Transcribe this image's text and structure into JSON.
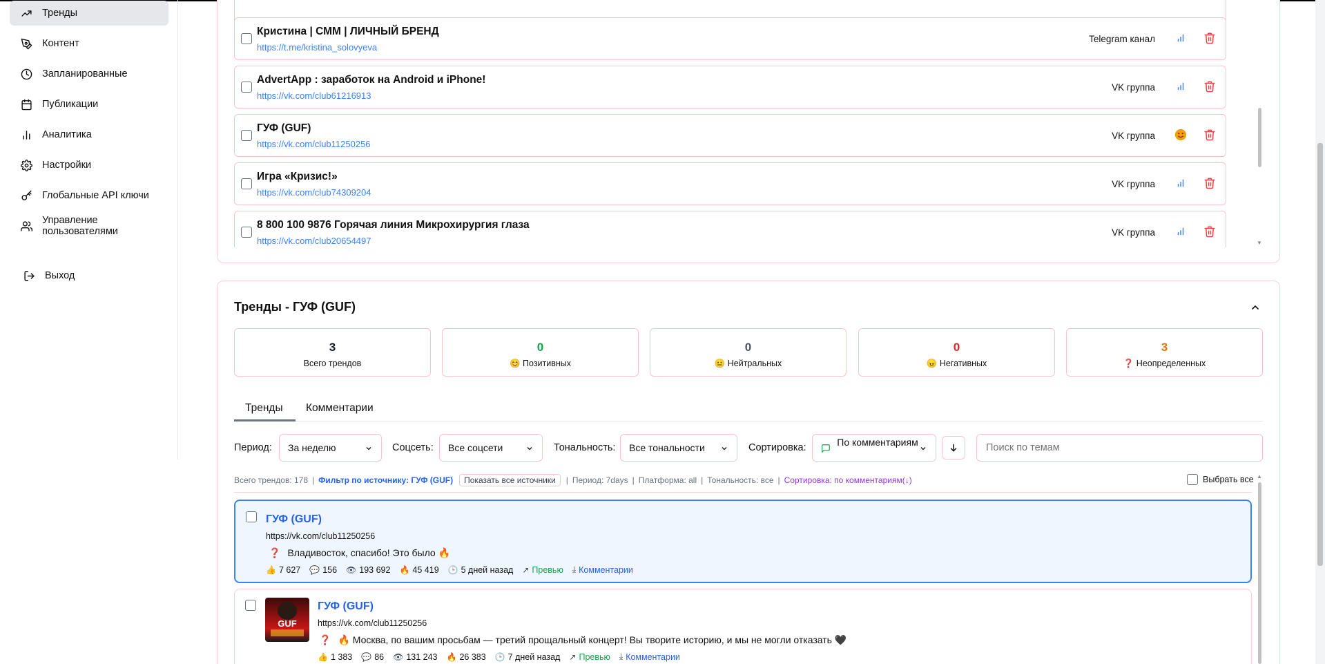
{
  "sidebar": {
    "items": [
      {
        "label": "Тренды",
        "icon": "trending-up-icon",
        "active": true
      },
      {
        "label": "Контент",
        "icon": "pen-tool-icon"
      },
      {
        "label": "Запланированные",
        "icon": "clock-icon"
      },
      {
        "label": "Публикации",
        "icon": "calendar-icon"
      },
      {
        "label": "Аналитика",
        "icon": "bar-chart-icon"
      },
      {
        "label": "Настройки",
        "icon": "gear-icon"
      },
      {
        "label": "Глобальные API ключи",
        "icon": "key-icon"
      },
      {
        "label": "Управление пользователями",
        "icon": "users-icon"
      }
    ],
    "logout": {
      "label": "Выход",
      "icon": "logout-icon"
    }
  },
  "sources": [
    {
      "name": "Кристина | СММ | ЛИЧНЫЙ БРЕНД",
      "url": "https://t.me/kristina_solovyeva",
      "platform": "Telegram канал",
      "indicator": "bar-chart-icon"
    },
    {
      "name": "AdvertApp : заработок на Android и iPhone!",
      "url": "https://vk.com/club61216913",
      "platform": "VK группа",
      "indicator": "bar-chart-icon"
    },
    {
      "name": "ГУФ (GUF)",
      "url": "https://vk.com/club11250256",
      "platform": "VK группа",
      "indicator": "smile-emoji-icon"
    },
    {
      "name": "Игра «Кризис!»",
      "url": "https://vk.com/club74309204",
      "platform": "VK группа",
      "indicator": "bar-chart-icon"
    },
    {
      "name": "8 800 100 9876 Горячая линия Микрохирургия глаза",
      "url": "https://vk.com/club20654497",
      "platform": "VK группа",
      "indicator": "bar-chart-icon"
    }
  ],
  "trends_panel": {
    "title": "Тренды - ГУФ (GUF)",
    "stats": [
      {
        "value": "3",
        "label": "Всего трендов",
        "emoji": "",
        "color": "#111827"
      },
      {
        "value": "0",
        "label": "Позитивных",
        "emoji": "😊",
        "color": "#16a34a"
      },
      {
        "value": "0",
        "label": "Нейтральных",
        "emoji": "😐",
        "color": "#4b5563"
      },
      {
        "value": "0",
        "label": "Негативных",
        "emoji": "😠",
        "color": "#dc2626"
      },
      {
        "value": "3",
        "label": "Неопределенных",
        "emoji": "❓",
        "color": "#d97706"
      }
    ],
    "tabs": [
      "Тренды",
      "Комментарии"
    ],
    "filters": {
      "period_label": "Период:",
      "period_value": "За неделю",
      "social_label": "Соцсеть:",
      "social_value": "Все соцсети",
      "tone_label": "Тональность:",
      "tone_value": "Все тональности",
      "sort_label": "Сортировка:",
      "sort_value": "По комментариям",
      "search_placeholder": "Поиск по темам"
    },
    "meta": {
      "total": "Всего трендов: 178",
      "source_filter": "Фильтр по источнику: ГУФ (GUF)",
      "show_all": "Показать все источники",
      "period": "Период: 7days",
      "platform": "Платформа: all",
      "tone": "Тональность: все",
      "sort": "Сортировка: по комментариям(↓)",
      "select_all": "Выбрать все"
    },
    "items": [
      {
        "title": "ГУФ (GUF)",
        "url": "https://vk.com/club11250256",
        "text": "Владивосток, спасибо! Это было 🔥",
        "likes": "7 627",
        "comments": "156",
        "views": "193 692",
        "engagement": "45 419",
        "ago": "5 дней назад",
        "preview": "Превью",
        "comments_link": "Комментарии"
      },
      {
        "title": "ГУФ (GUF)",
        "url": "https://vk.com/club11250256",
        "text": "🔥 Москва, по вашим просьбам — третий прощальный концерт! Вы творите историю, и мы не могли отказать 🖤",
        "likes": "1 383",
        "comments": "86",
        "views": "131 243",
        "engagement": "26 383",
        "ago": "7 дней назад",
        "preview": "Превью",
        "comments_link": "Комментарии",
        "thumb_text": "GUF"
      }
    ]
  }
}
